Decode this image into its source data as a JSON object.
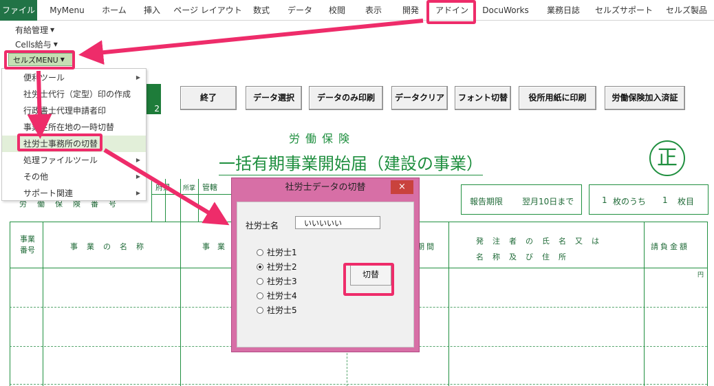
{
  "ribbon": {
    "tabs": [
      "ファイル",
      "MyMenu",
      "ホーム",
      "挿入",
      "ページ レイアウト",
      "数式",
      "データ",
      "校閲",
      "表示",
      "開発",
      "アドイン",
      "DocuWorks",
      "業務日誌",
      "セルズサポート",
      "セルズ製品"
    ]
  },
  "addin": {
    "menu1": "有給管理",
    "menu2": "Cells給与",
    "menu3": "セルズMENU"
  },
  "dropdown": {
    "items": [
      "便利ツール",
      "社労士代行（定型）印の作成",
      "行政書士代理申請者印",
      "事業主所在地の一時切替",
      "社労士事務所の切替",
      "処理ファイルツール",
      "その他",
      "サポート関連"
    ]
  },
  "toolbar": {
    "green_num": "2",
    "buttons": [
      "終了",
      "データ選択",
      "データのみ印刷",
      "データクリア",
      "フォント切替",
      "役所用紙に印刷",
      "労働保険加入済証"
    ]
  },
  "form": {
    "subtitle": "労働保険",
    "title": "一括有期事業開始届（建設の事業）",
    "seal": "正",
    "deadline_label": "報告期限",
    "deadline_value": "翌月10日まで",
    "page_num1": "1",
    "page_label1": "枚のうち",
    "page_num2": "1",
    "page_label2": "枚目",
    "partial_fu": "府県",
    "partial_sho": "所掌",
    "partial_kan": "管轄",
    "partial_row": "労　働　保　険　番　号",
    "col_number": "事業\n番号",
    "col_name": "事　業　の　名　称",
    "col_loc": "事　業",
    "col_period": "期間",
    "col_orderer1": "発　注　者　の　氏　名　又　は",
    "col_orderer2": "名　称　及　び　住　所",
    "col_amount": "請負金額",
    "yen": "円"
  },
  "dialog": {
    "title": "社労士データの切替",
    "close": "×",
    "name_label": "社労士名",
    "name_value": "いいいいい",
    "radios": [
      "社労士1",
      "社労士2",
      "社労士3",
      "社労士4",
      "社労士5"
    ],
    "selected_radio": "社労士2",
    "switch_button": "切替"
  },
  "colors": {
    "excel_green": "#217346",
    "highlight_pink": "#ee2c6a",
    "form_green": "#1f8f3f",
    "dialog_pink": "#d76fa6"
  }
}
